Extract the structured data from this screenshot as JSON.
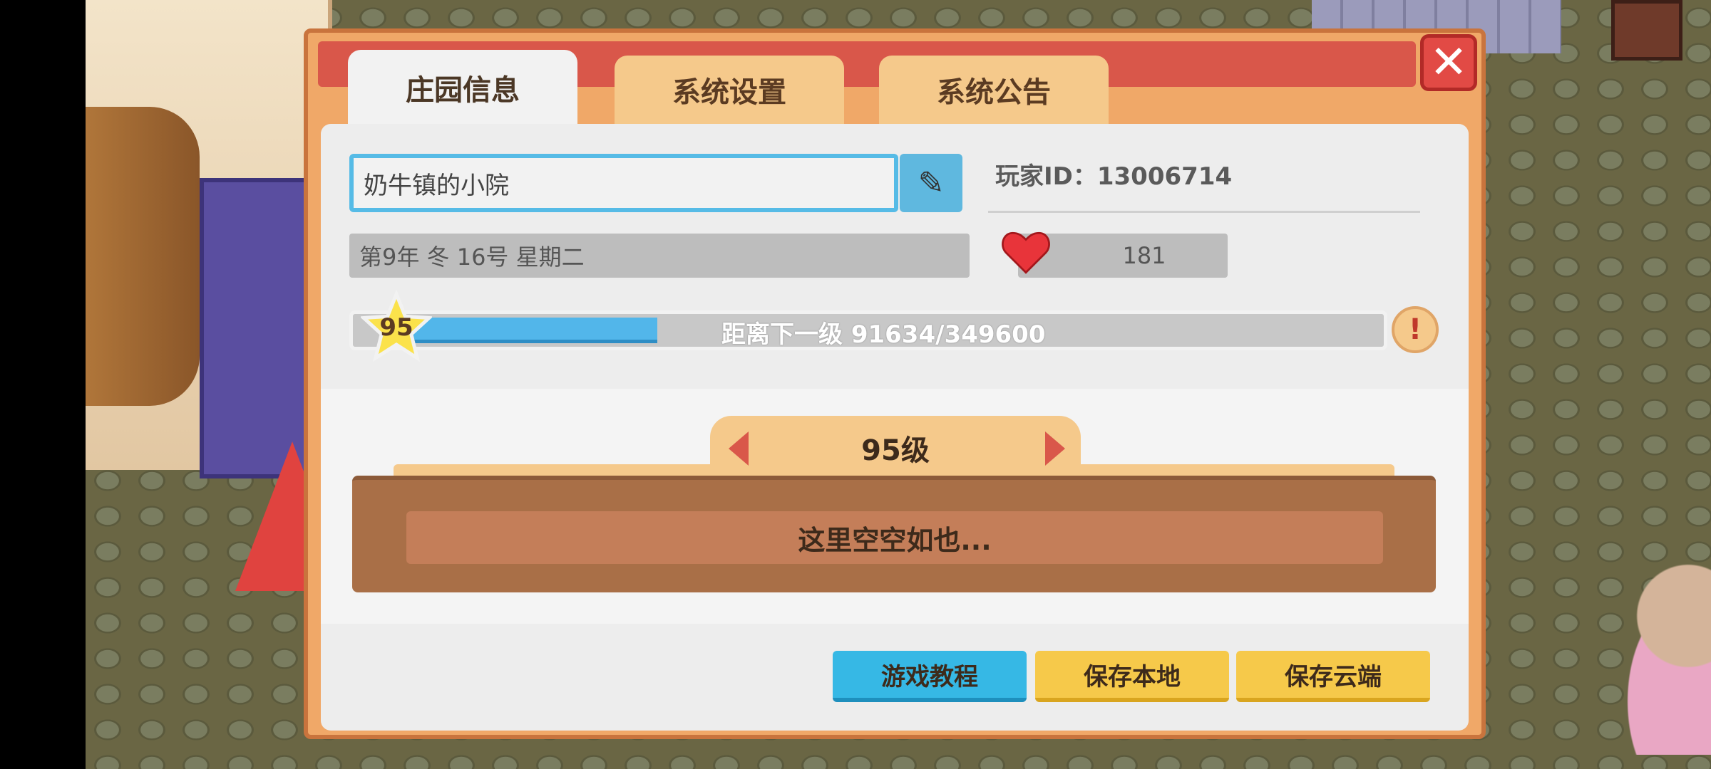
{
  "tabs": [
    {
      "label": "庄园信息",
      "active": true
    },
    {
      "label": "系统设置",
      "active": false
    },
    {
      "label": "系统公告",
      "active": false
    }
  ],
  "close_icon": "close-icon",
  "farm": {
    "name_value": "奶牛镇的小院",
    "edit_icon": "pencil-icon",
    "player_id_label": "玩家ID：13006714",
    "date": "第9年  冬  16号 星期二",
    "hearts": "181",
    "heart_icon": "heart-icon"
  },
  "level": {
    "current": "95",
    "progress_text": "距离下一级   91634/349600",
    "progress_fraction": 0.262,
    "info_icon": "exclamation-icon"
  },
  "rewards": {
    "title": "95级",
    "empty_text": "这里空空如也..."
  },
  "buttons": {
    "tutorial": "游戏教程",
    "save_local": "保存本地",
    "save_cloud": "保存云端"
  },
  "colors": {
    "accent_red": "#d9574a",
    "tab_active": "#f2f2f2",
    "tab_inactive": "#f5c98b",
    "progress": "#52b6ea",
    "button_blue": "#36b8e5",
    "button_yellow": "#f6c94a"
  }
}
